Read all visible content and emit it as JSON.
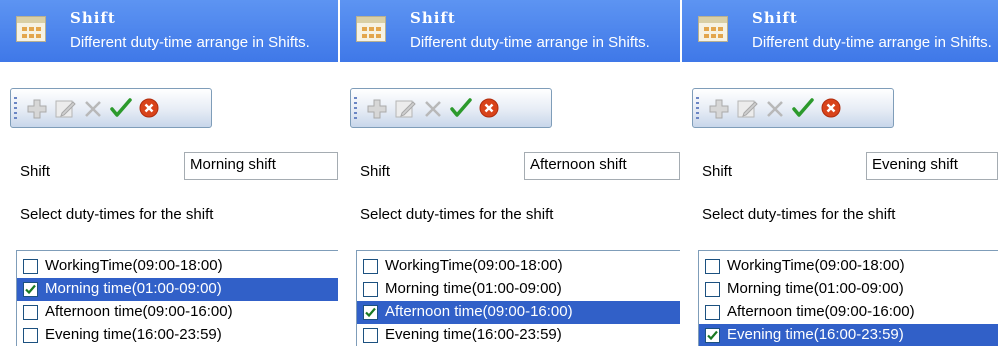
{
  "panels": [
    {
      "header": {
        "title": "Shift",
        "subtitle": "Different duty-time arrange in Shifts."
      },
      "toolbar": {
        "icons": [
          "add-icon",
          "edit-icon",
          "delete-icon",
          "confirm-icon",
          "cancel-icon"
        ]
      },
      "form": {
        "shift_label": "Shift",
        "shift_value": "Morning shift",
        "select_label": "Select duty-times for the shift"
      },
      "duty_times": [
        {
          "label": "WorkingTime(09:00-18:00)",
          "checked": false,
          "selected": false
        },
        {
          "label": "Morning time(01:00-09:00)",
          "checked": true,
          "selected": true
        },
        {
          "label": "Afternoon time(09:00-16:00)",
          "checked": false,
          "selected": false
        },
        {
          "label": "Evening time(16:00-23:59)",
          "checked": false,
          "selected": false
        }
      ]
    },
    {
      "header": {
        "title": "Shift",
        "subtitle": "Different duty-time arrange in Shifts."
      },
      "toolbar": {
        "icons": [
          "add-icon",
          "edit-icon",
          "delete-icon",
          "confirm-icon",
          "cancel-icon"
        ]
      },
      "form": {
        "shift_label": "Shift",
        "shift_value": "Afternoon shift",
        "select_label": "Select duty-times for the shift"
      },
      "duty_times": [
        {
          "label": "WorkingTime(09:00-18:00)",
          "checked": false,
          "selected": false
        },
        {
          "label": "Morning time(01:00-09:00)",
          "checked": false,
          "selected": false
        },
        {
          "label": "Afternoon time(09:00-16:00)",
          "checked": true,
          "selected": true
        },
        {
          "label": "Evening time(16:00-23:59)",
          "checked": false,
          "selected": false
        }
      ]
    },
    {
      "header": {
        "title": "Shift",
        "subtitle": "Different duty-time arrange in Shifts."
      },
      "toolbar": {
        "icons": [
          "add-icon",
          "edit-icon",
          "delete-icon",
          "confirm-icon",
          "cancel-icon"
        ]
      },
      "form": {
        "shift_label": "Shift",
        "shift_value": "Evening shift",
        "select_label": "Select duty-times for the shift"
      },
      "duty_times": [
        {
          "label": "WorkingTime(09:00-18:00)",
          "checked": false,
          "selected": false
        },
        {
          "label": "Morning time(01:00-09:00)",
          "checked": false,
          "selected": false
        },
        {
          "label": "Afternoon time(09:00-16:00)",
          "checked": false,
          "selected": false
        },
        {
          "label": "Evening time(16:00-23:59)",
          "checked": true,
          "selected": true
        }
      ]
    }
  ],
  "colors": {
    "header": "#4a85ee",
    "selection": "#3160c8",
    "check": "#1b7a22"
  }
}
